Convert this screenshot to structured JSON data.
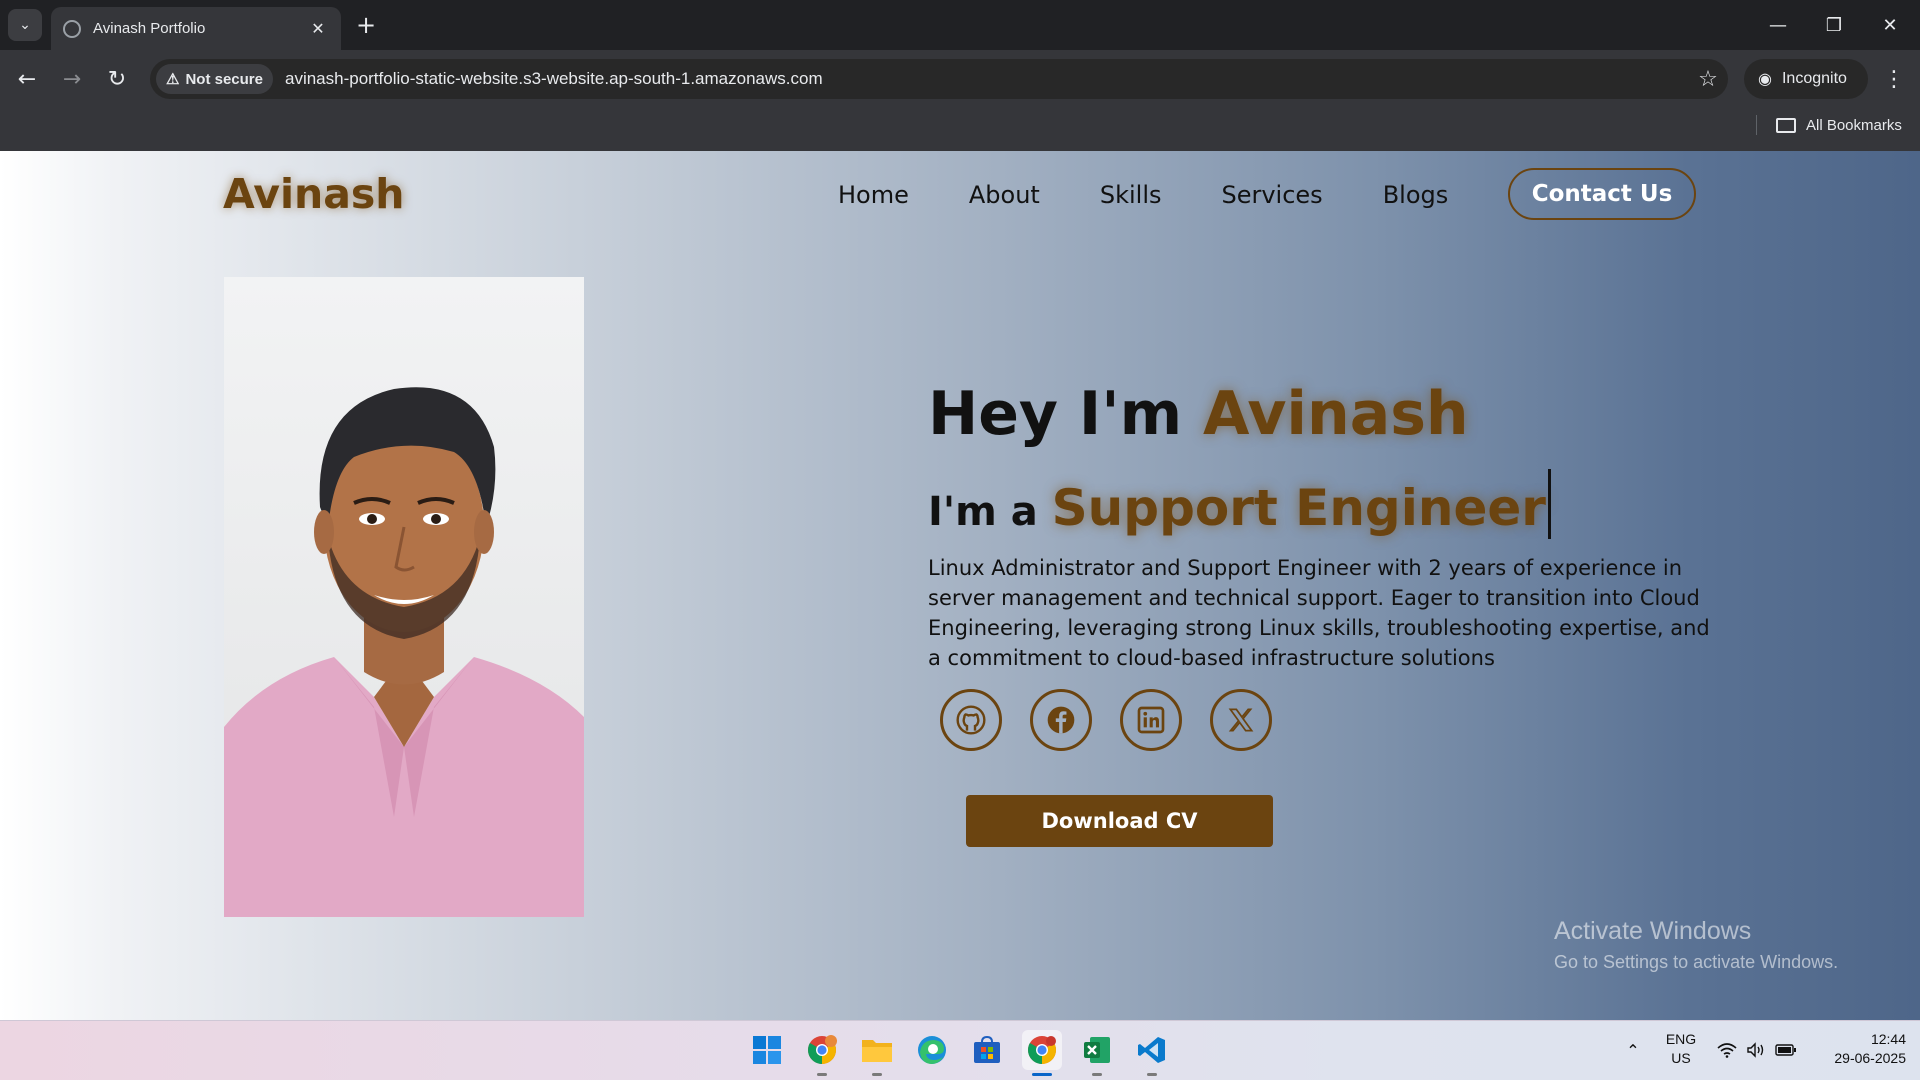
{
  "browser": {
    "tab_title": "Avinash Portfolio",
    "security_label": "Not secure",
    "url": "avinash-portfolio-static-website.s3-website.ap-south-1.amazonaws.com",
    "incognito_label": "Incognito",
    "bookmarks_label": "All Bookmarks"
  },
  "site": {
    "logo": "Avinash",
    "nav": [
      "Home",
      "About",
      "Skills",
      "Services",
      "Blogs"
    ],
    "contact_label": "Contact Us",
    "greeting_prefix": "Hey I'm",
    "greeting_name": "Avinash",
    "role_prefix": "I'm a",
    "role_value": "Support Engineer",
    "bio": "Linux Administrator and Support Engineer with 2 years of experience in server management and technical support. Eager to transition into Cloud Engineering, leveraging strong Linux skills, troubleshooting expertise, and a commitment to cloud-based infrastructure solutions",
    "socials": [
      "github-icon",
      "facebook-icon",
      "linkedin-icon",
      "x-icon"
    ],
    "download_label": "Download CV",
    "accent_color": "#6b4410"
  },
  "watermark": {
    "title": "Activate Windows",
    "subtitle": "Go to Settings to activate Windows."
  },
  "taskbar": {
    "apps": [
      "windows-start-icon",
      "chrome-profile-icon",
      "file-explorer-icon",
      "edge-icon",
      "microsoft-store-icon",
      "chrome-icon",
      "excel-icon",
      "vscode-icon"
    ],
    "lang_line1": "ENG",
    "lang_line2": "US",
    "time": "12:44",
    "date": "29-06-2025"
  }
}
